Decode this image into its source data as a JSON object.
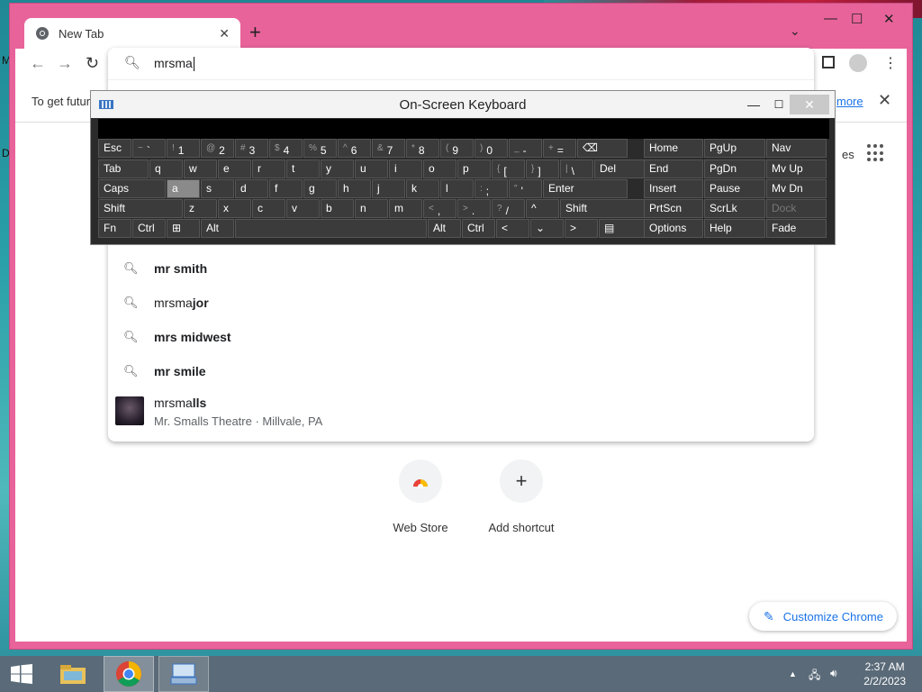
{
  "desktop": {
    "letters": [
      "M",
      "D"
    ]
  },
  "browser": {
    "tab": {
      "title": "New Tab"
    },
    "new_tab": "+",
    "tab_menu": "⌄",
    "window": {
      "minimize": "—",
      "maximize": "☐",
      "close": "✕"
    },
    "nav": {
      "back": "←",
      "forward": "→",
      "reload": "↻"
    },
    "infobar": {
      "text": "To get futur",
      "link": "more",
      "close": "✕"
    },
    "ntp_right_fragment": "es",
    "omnibox": {
      "value": "mrsma",
      "suggestions": [
        {
          "prefix": "",
          "bold": "mr smith"
        },
        {
          "prefix": "mrsma",
          "bold": "jor"
        },
        {
          "prefix": "",
          "bold": "mrs midwest"
        },
        {
          "prefix": "",
          "bold": "mr smile"
        }
      ],
      "entity": {
        "prefix": "mrsma",
        "bold": "lls",
        "subtitle": "Mr. Smalls Theatre · Millvale, PA"
      }
    },
    "shortcuts": [
      {
        "label": "Web Store"
      },
      {
        "label": "Add shortcut",
        "icon": "+"
      }
    ],
    "customize": "Customize Chrome"
  },
  "osk": {
    "title": "On-Screen Keyboard",
    "minimize": "—",
    "maximize": "☐",
    "close": "✕",
    "rows": [
      [
        {
          "m": "Esc"
        },
        {
          "s": "~",
          "m": "`"
        },
        {
          "s": "!",
          "m": "1"
        },
        {
          "s": "@",
          "m": "2"
        },
        {
          "s": "#",
          "m": "3"
        },
        {
          "s": "$",
          "m": "4"
        },
        {
          "s": "%",
          "m": "5"
        },
        {
          "s": "^",
          "m": "6"
        },
        {
          "s": "&",
          "m": "7"
        },
        {
          "s": "*",
          "m": "8"
        },
        {
          "s": "(",
          "m": "9"
        },
        {
          "s": ")",
          "m": "0"
        },
        {
          "s": "_",
          "m": "-"
        },
        {
          "s": "+",
          "m": "="
        },
        {
          "m": "⌫"
        }
      ],
      [
        {
          "m": "Tab"
        },
        {
          "m": "q"
        },
        {
          "m": "w"
        },
        {
          "m": "e"
        },
        {
          "m": "r"
        },
        {
          "m": "t"
        },
        {
          "m": "y"
        },
        {
          "m": "u"
        },
        {
          "m": "i"
        },
        {
          "m": "o"
        },
        {
          "m": "p"
        },
        {
          "s": "{",
          "m": "["
        },
        {
          "s": "}",
          "m": "]"
        },
        {
          "s": "|",
          "m": "\\"
        },
        {
          "m": "Del"
        }
      ],
      [
        {
          "m": "Caps"
        },
        {
          "m": "a"
        },
        {
          "m": "s"
        },
        {
          "m": "d"
        },
        {
          "m": "f"
        },
        {
          "m": "g"
        },
        {
          "m": "h"
        },
        {
          "m": "j"
        },
        {
          "m": "k"
        },
        {
          "m": "l"
        },
        {
          "s": ":",
          "m": ";"
        },
        {
          "s": "\"",
          "m": "'"
        },
        {
          "m": "Enter"
        }
      ],
      [
        {
          "m": "Shift"
        },
        {
          "m": "z"
        },
        {
          "m": "x"
        },
        {
          "m": "c"
        },
        {
          "m": "v"
        },
        {
          "m": "b"
        },
        {
          "m": "n"
        },
        {
          "m": "m"
        },
        {
          "s": "<",
          "m": ","
        },
        {
          "s": ">",
          "m": "."
        },
        {
          "s": "?",
          "m": "/"
        },
        {
          "m": "^"
        },
        {
          "m": "Shift"
        }
      ],
      [
        {
          "m": "Fn"
        },
        {
          "m": "Ctrl"
        },
        {
          "m": "⊞"
        },
        {
          "m": "Alt"
        },
        {
          "m": ""
        },
        {
          "m": "Alt"
        },
        {
          "m": "Ctrl"
        },
        {
          "m": "<"
        },
        {
          "m": "⌄"
        },
        {
          "m": ">"
        },
        {
          "m": "▤"
        }
      ]
    ],
    "nav_rows": [
      [
        "Home",
        "PgUp",
        "Nav"
      ],
      [
        "End",
        "PgDn",
        "Mv Up"
      ],
      [
        "Insert",
        "Pause",
        "Mv Dn"
      ],
      [
        "PrtScn",
        "ScrLk",
        "Dock"
      ],
      [
        "Options",
        "Help",
        "Fade"
      ]
    ]
  },
  "taskbar": {
    "time": "2:37 AM",
    "date": "2/2/2023",
    "tray_up": "▲"
  }
}
